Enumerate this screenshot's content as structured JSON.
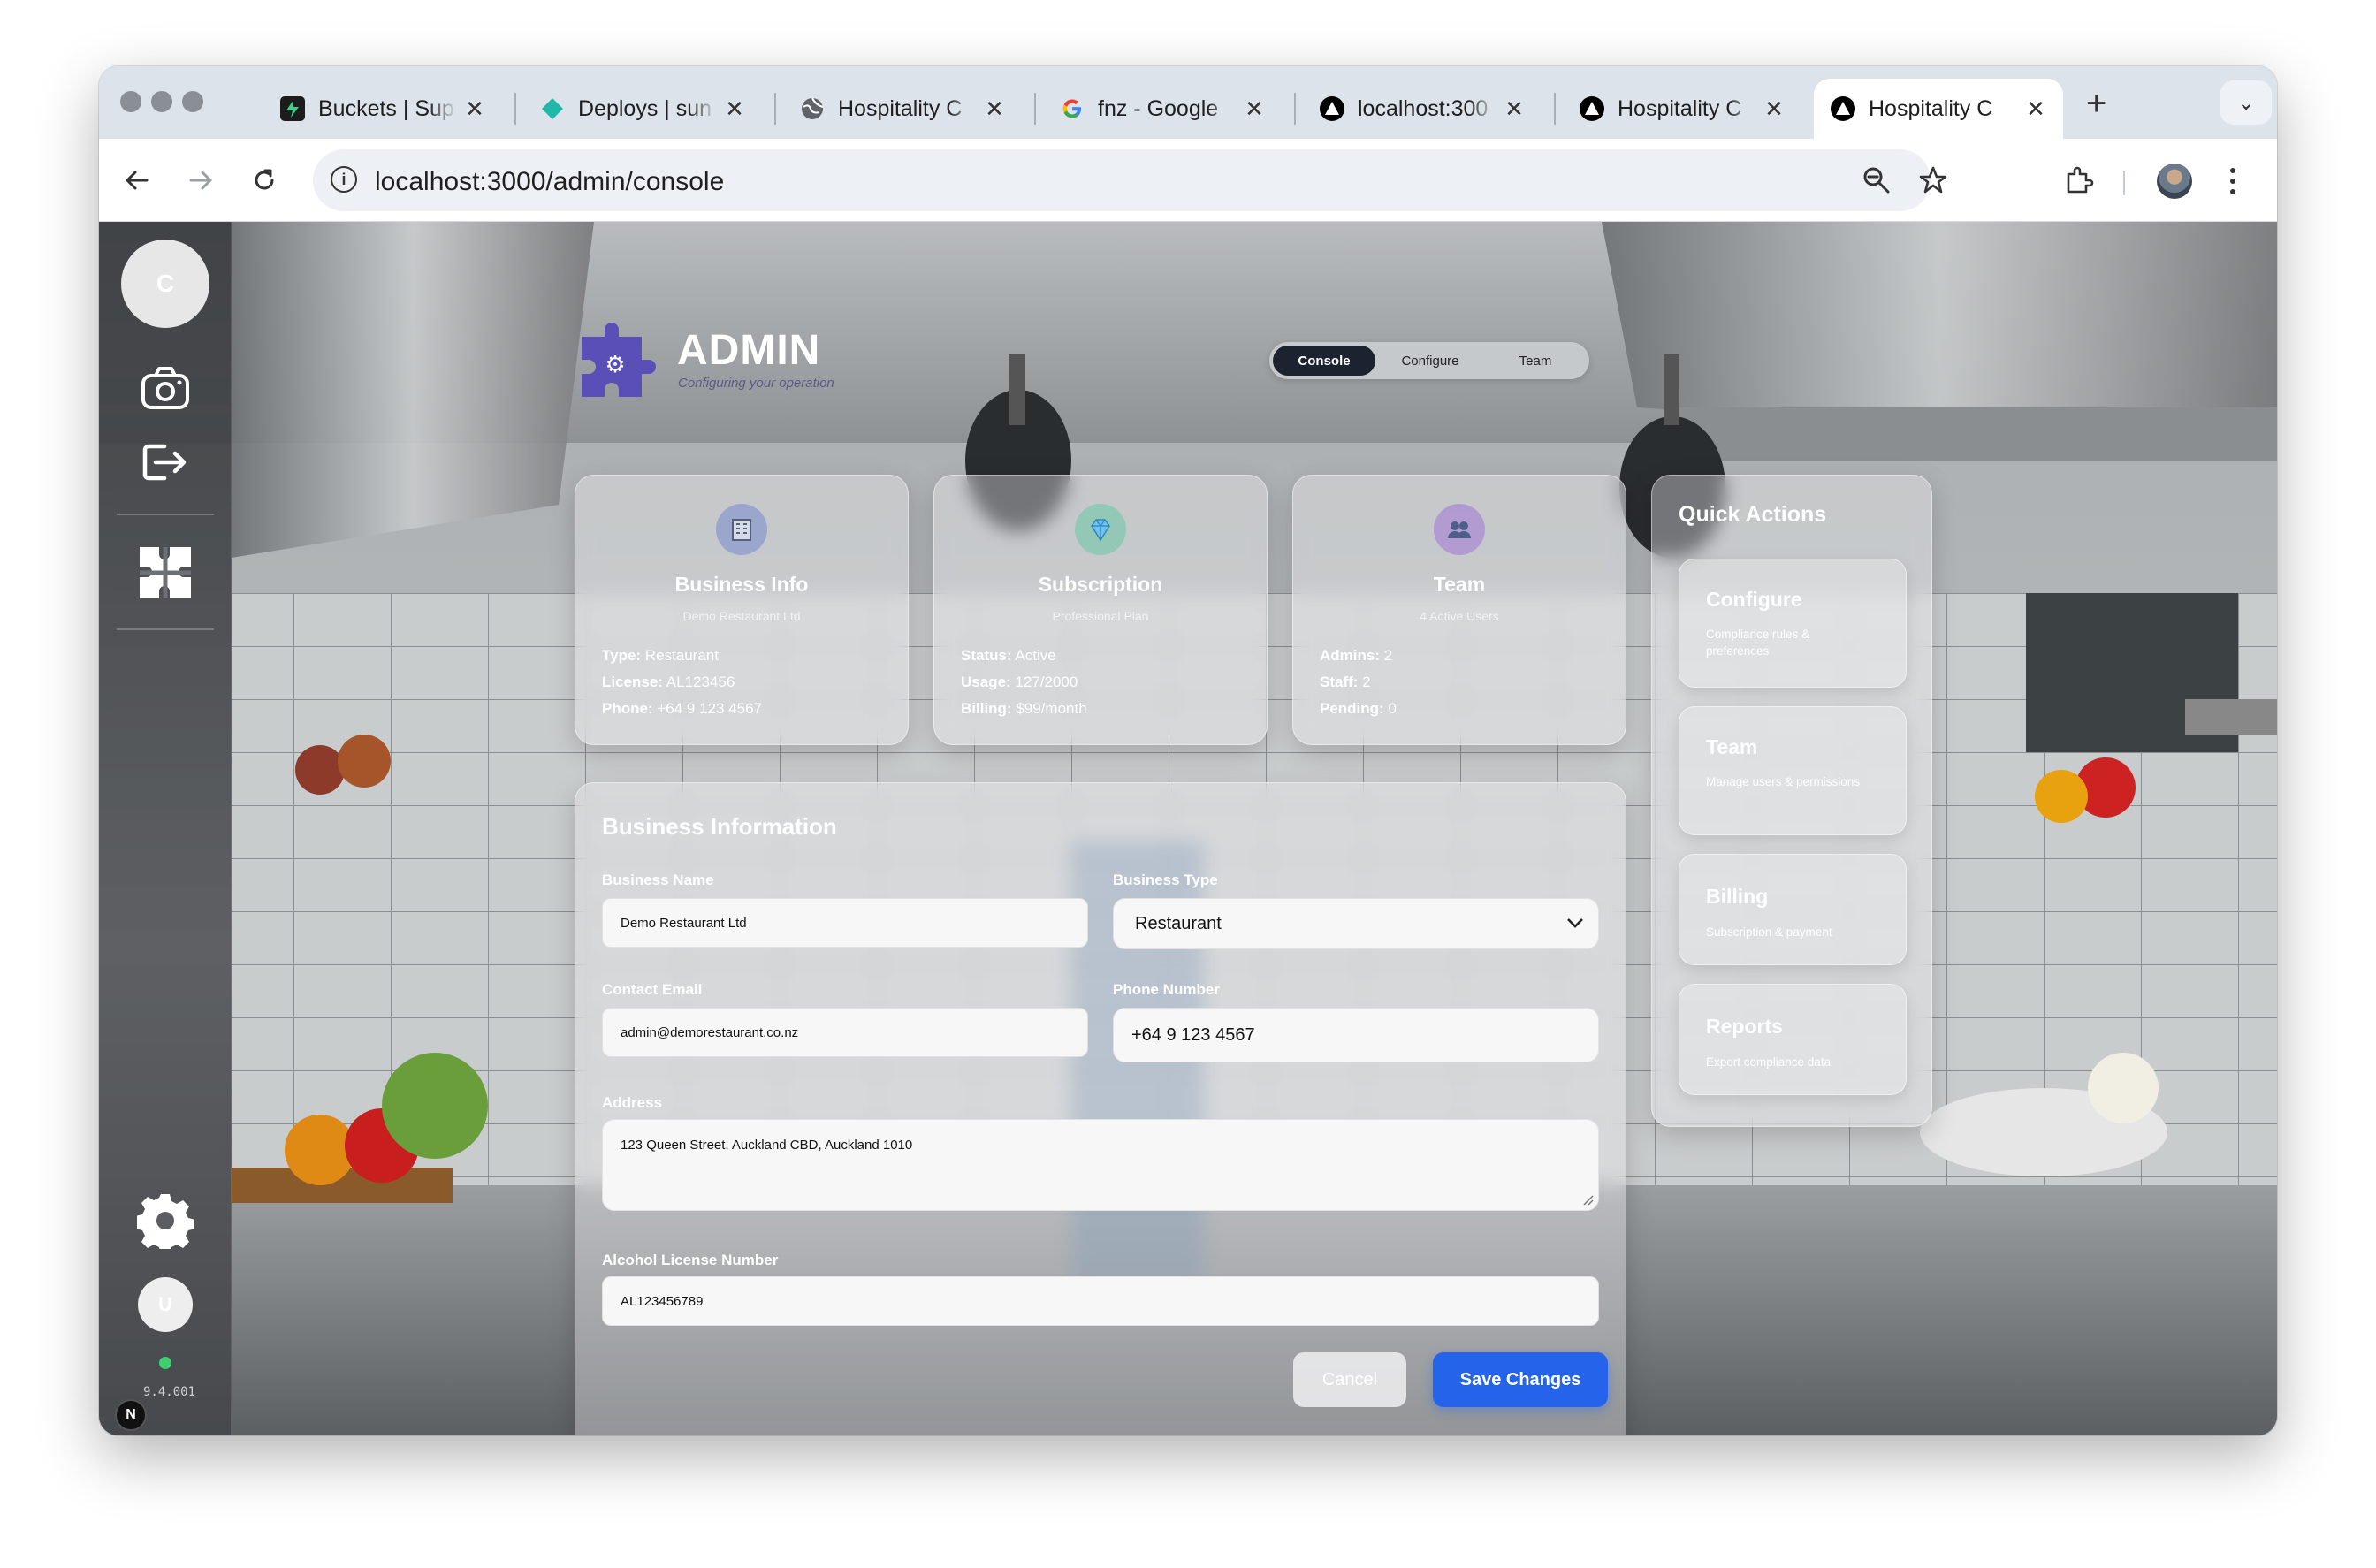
{
  "browser": {
    "tabs": [
      {
        "title": "Buckets | Sup",
        "icon": "supabase-icon"
      },
      {
        "title": "Deploys | sun",
        "icon": "netlify-icon"
      },
      {
        "title": "Hospitality C",
        "icon": "globe-icon"
      },
      {
        "title": "fnz - Google",
        "icon": "google-icon"
      },
      {
        "title": "localhost:300",
        "icon": "nextjs-icon"
      },
      {
        "title": "Hospitality C",
        "icon": "nextjs-icon"
      },
      {
        "title": "Hospitality C",
        "icon": "nextjs-icon",
        "active": true
      }
    ],
    "url": "localhost:3000/admin/console"
  },
  "sidebar": {
    "avatar_top": "C",
    "avatar_bottom": "U",
    "version": "9.4.001",
    "status_color": "#3ecf6e"
  },
  "header": {
    "title": "ADMIN",
    "subtitle": "Configuring your operation",
    "tabs": [
      "Console",
      "Configure",
      "Team"
    ],
    "active_tab": "Console"
  },
  "cards": {
    "business": {
      "title": "Business Info",
      "subtitle": "Demo Restaurant Ltd",
      "icon": "building-icon",
      "l1k": "Type:",
      "l1v": " Restaurant",
      "l2k": "License:",
      "l2v": " AL123456",
      "l3k": "Phone:",
      "l3v": " +64 9 123 4567"
    },
    "subscription": {
      "title": "Subscription",
      "subtitle": "Professional Plan",
      "icon": "diamond-icon",
      "l1k": "Status:",
      "l1v": " Active",
      "l2k": "Usage:",
      "l2v": " 127/2000",
      "l3k": "Billing:",
      "l3v": " $99/month"
    },
    "team": {
      "title": "Team",
      "subtitle": "4 Active Users",
      "icon": "users-icon",
      "l1k": "Admins:",
      "l1v": " 2",
      "l2k": "Staff:",
      "l2v": " 2",
      "l3k": "Pending:",
      "l3v": " 0"
    }
  },
  "quick_actions": {
    "title": "Quick Actions",
    "items": [
      {
        "title": "Configure",
        "desc": "Compliance rules & preferences"
      },
      {
        "title": "Team",
        "desc": "Manage users & permissions"
      },
      {
        "title": "Billing",
        "desc": "Subscription & payment"
      },
      {
        "title": "Reports",
        "desc": "Export compliance data"
      }
    ]
  },
  "form": {
    "title": "Business Information",
    "business_name_label": "Business Name",
    "business_name": "Demo Restaurant Ltd",
    "business_type_label": "Business Type",
    "business_type": "Restaurant",
    "email_label": "Contact Email",
    "email": "admin@demorestaurant.co.nz",
    "phone_label": "Phone Number",
    "phone": "+64 9 123 4567",
    "address_label": "Address",
    "address": "123 Queen Street, Auckland CBD, Auckland 1010",
    "license_label": "Alcohol License Number",
    "license": "AL123456789",
    "cancel": "Cancel",
    "save": "Save Changes"
  },
  "colors": {
    "primary": "#2563eb",
    "pill_active": "#1c2230"
  }
}
